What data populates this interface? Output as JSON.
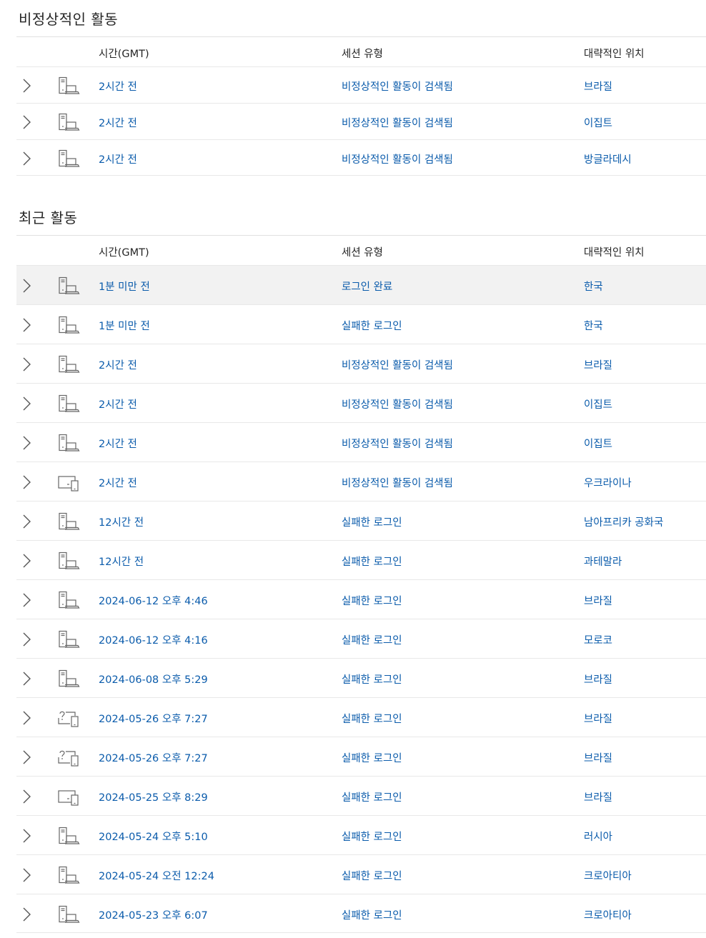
{
  "unusual": {
    "title": "비정상적인 활동",
    "headers": {
      "time": "시간(GMT)",
      "type": "세션 유형",
      "location": "대략적인 위치"
    },
    "rows": [
      {
        "time": "2시간 전",
        "type": "비정상적인 활동이 검색됨",
        "location": "브라질",
        "icon": "desktop-laptop-icon"
      },
      {
        "time": "2시간 전",
        "type": "비정상적인 활동이 검색됨",
        "location": "이집트",
        "icon": "desktop-laptop-icon"
      },
      {
        "time": "2시간 전",
        "type": "비정상적인 활동이 검색됨",
        "location": "방글라데시",
        "icon": "desktop-laptop-icon"
      }
    ]
  },
  "recent": {
    "title": "최근 활동",
    "headers": {
      "time": "시간(GMT)",
      "type": "세션 유형",
      "location": "대략적인 위치"
    },
    "rows": [
      {
        "time": "1분 미만 전",
        "type": "로그인 완료",
        "location": "한국",
        "icon": "desktop-laptop-icon"
      },
      {
        "time": "1분 미만 전",
        "type": "실패한 로그인",
        "location": "한국",
        "icon": "desktop-laptop-icon"
      },
      {
        "time": "2시간 전",
        "type": "비정상적인 활동이 검색됨",
        "location": "브라질",
        "icon": "desktop-laptop-icon"
      },
      {
        "time": "2시간 전",
        "type": "비정상적인 활동이 검색됨",
        "location": "이집트",
        "icon": "desktop-laptop-icon"
      },
      {
        "time": "2시간 전",
        "type": "비정상적인 활동이 검색됨",
        "location": "이집트",
        "icon": "desktop-laptop-icon"
      },
      {
        "time": "2시간 전",
        "type": "비정상적인 활동이 검색됨",
        "location": "우크라이나",
        "icon": "monitor-phone-icon"
      },
      {
        "time": "12시간 전",
        "type": "실패한 로그인",
        "location": "남아프리카 공화국",
        "icon": "desktop-laptop-icon"
      },
      {
        "time": "12시간 전",
        "type": "실패한 로그인",
        "location": "과테말라",
        "icon": "desktop-laptop-icon"
      },
      {
        "time": "2024-06-12 오후 4:46",
        "type": "실패한 로그인",
        "location": "브라질",
        "icon": "desktop-laptop-icon"
      },
      {
        "time": "2024-06-12 오후 4:16",
        "type": "실패한 로그인",
        "location": "모로코",
        "icon": "desktop-laptop-icon"
      },
      {
        "time": "2024-06-08 오후 5:29",
        "type": "실패한 로그인",
        "location": "브라질",
        "icon": "desktop-laptop-icon"
      },
      {
        "time": "2024-05-26 오후 7:27",
        "type": "실패한 로그인",
        "location": "브라질",
        "icon": "unknown-device-icon"
      },
      {
        "time": "2024-05-26 오후 7:27",
        "type": "실패한 로그인",
        "location": "브라질",
        "icon": "unknown-device-icon"
      },
      {
        "time": "2024-05-25 오후 8:29",
        "type": "실패한 로그인",
        "location": "브라질",
        "icon": "monitor-phone-icon"
      },
      {
        "time": "2024-05-24 오후 5:10",
        "type": "실패한 로그인",
        "location": "러시아",
        "icon": "desktop-laptop-icon"
      },
      {
        "time": "2024-05-24 오전 12:24",
        "type": "실패한 로그인",
        "location": "크로아티아",
        "icon": "desktop-laptop-icon"
      },
      {
        "time": "2024-05-23 오후 6:07",
        "type": "실패한 로그인",
        "location": "크로아티아",
        "icon": "desktop-laptop-icon"
      }
    ]
  },
  "colors": {
    "link": "#0a5bab",
    "text": "#262626",
    "divider": "#e8e8e8",
    "selected_row": "#f2f2f2"
  },
  "selected_row": "recent.rows.0"
}
